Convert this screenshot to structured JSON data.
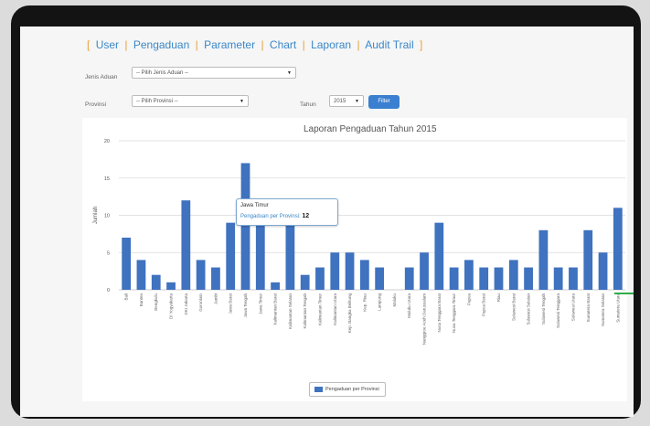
{
  "nav": {
    "items": [
      "User",
      "Pengaduan",
      "Parameter",
      "Chart",
      "Laporan",
      "Audit Trail"
    ]
  },
  "filters": {
    "jenis_aduan_label": "Jenis Aduan",
    "jenis_aduan_value": "-- Pilih Jenis Aduan --",
    "provinsi_label": "Provinsi",
    "provinsi_value": "-- Pilih Provinsi --",
    "tahun_label": "Tahun",
    "tahun_value": "2015",
    "filter_button": "Filter"
  },
  "tooltip": {
    "title": "Jawa Timur",
    "series_label": "Pengaduan per Provinsi",
    "value": "12"
  },
  "colors": {
    "bar": "#3f72bf",
    "nav_link": "#3a87c8",
    "nav_separator": "#e8a23a",
    "button": "#3a7fd0"
  },
  "chart_data": {
    "type": "bar",
    "title": "Laporan Pengaduan Tahun 2015",
    "ylabel": "Jumlah",
    "xlabel": "",
    "ylim": [
      0,
      20
    ],
    "yticks": [
      0,
      5,
      10,
      15,
      20
    ],
    "grid": true,
    "legend_position": "bottom",
    "categories": [
      "Bali",
      "Banten",
      "Bengkulu",
      "DI Yogyakarta",
      "DKI Jakarta",
      "Gorontalo",
      "Jambi",
      "Jawa Barat",
      "Jawa Tengah",
      "Jawa Timur",
      "Kalimantan Barat",
      "Kalimantan Selatan",
      "Kalimantan Tengah",
      "Kalimantan Timur",
      "Kalimantan Utara",
      "Kep. Bangka Belitung",
      "Kep. Riau",
      "Lampung",
      "Maluku",
      "Maluku Utara",
      "Nanggroe Aceh Darussalam",
      "Nusa Tenggara Barat",
      "Nusa Tenggara Timur",
      "Papua",
      "Papua Barat",
      "Riau",
      "Sulawesi Barat",
      "Sulawesi Selatan",
      "Sulawesi Tengah",
      "Sulawesi Tenggara",
      "Sulawesi Utara",
      "Sumatera Barat",
      "Sumatera Selatan",
      "Sumatera Utara"
    ],
    "series": [
      {
        "name": "Pengaduan per Provinsi",
        "values": [
          7,
          4,
          2,
          1,
          12,
          4,
          3,
          9,
          17,
          12,
          1,
          12,
          2,
          3,
          5,
          5,
          4,
          3,
          0,
          3,
          5,
          9,
          3,
          4,
          3,
          3,
          4,
          3,
          8,
          3,
          3,
          8,
          5,
          11
        ]
      }
    ]
  }
}
